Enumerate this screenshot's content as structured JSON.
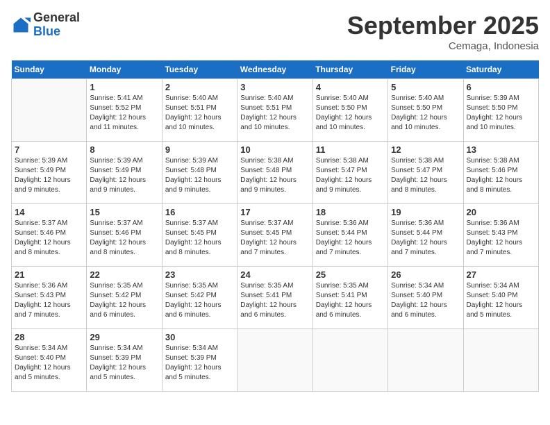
{
  "header": {
    "logo_general": "General",
    "logo_blue": "Blue",
    "month_title": "September 2025",
    "location": "Cemaga, Indonesia"
  },
  "days_of_week": [
    "Sunday",
    "Monday",
    "Tuesday",
    "Wednesday",
    "Thursday",
    "Friday",
    "Saturday"
  ],
  "weeks": [
    [
      {
        "day": "",
        "info": ""
      },
      {
        "day": "1",
        "info": "Sunrise: 5:41 AM\nSunset: 5:52 PM\nDaylight: 12 hours\nand 11 minutes."
      },
      {
        "day": "2",
        "info": "Sunrise: 5:40 AM\nSunset: 5:51 PM\nDaylight: 12 hours\nand 10 minutes."
      },
      {
        "day": "3",
        "info": "Sunrise: 5:40 AM\nSunset: 5:51 PM\nDaylight: 12 hours\nand 10 minutes."
      },
      {
        "day": "4",
        "info": "Sunrise: 5:40 AM\nSunset: 5:50 PM\nDaylight: 12 hours\nand 10 minutes."
      },
      {
        "day": "5",
        "info": "Sunrise: 5:40 AM\nSunset: 5:50 PM\nDaylight: 12 hours\nand 10 minutes."
      },
      {
        "day": "6",
        "info": "Sunrise: 5:39 AM\nSunset: 5:50 PM\nDaylight: 12 hours\nand 10 minutes."
      }
    ],
    [
      {
        "day": "7",
        "info": "Sunrise: 5:39 AM\nSunset: 5:49 PM\nDaylight: 12 hours\nand 9 minutes."
      },
      {
        "day": "8",
        "info": "Sunrise: 5:39 AM\nSunset: 5:49 PM\nDaylight: 12 hours\nand 9 minutes."
      },
      {
        "day": "9",
        "info": "Sunrise: 5:39 AM\nSunset: 5:48 PM\nDaylight: 12 hours\nand 9 minutes."
      },
      {
        "day": "10",
        "info": "Sunrise: 5:38 AM\nSunset: 5:48 PM\nDaylight: 12 hours\nand 9 minutes."
      },
      {
        "day": "11",
        "info": "Sunrise: 5:38 AM\nSunset: 5:47 PM\nDaylight: 12 hours\nand 9 minutes."
      },
      {
        "day": "12",
        "info": "Sunrise: 5:38 AM\nSunset: 5:47 PM\nDaylight: 12 hours\nand 8 minutes."
      },
      {
        "day": "13",
        "info": "Sunrise: 5:38 AM\nSunset: 5:46 PM\nDaylight: 12 hours\nand 8 minutes."
      }
    ],
    [
      {
        "day": "14",
        "info": "Sunrise: 5:37 AM\nSunset: 5:46 PM\nDaylight: 12 hours\nand 8 minutes."
      },
      {
        "day": "15",
        "info": "Sunrise: 5:37 AM\nSunset: 5:46 PM\nDaylight: 12 hours\nand 8 minutes."
      },
      {
        "day": "16",
        "info": "Sunrise: 5:37 AM\nSunset: 5:45 PM\nDaylight: 12 hours\nand 8 minutes."
      },
      {
        "day": "17",
        "info": "Sunrise: 5:37 AM\nSunset: 5:45 PM\nDaylight: 12 hours\nand 7 minutes."
      },
      {
        "day": "18",
        "info": "Sunrise: 5:36 AM\nSunset: 5:44 PM\nDaylight: 12 hours\nand 7 minutes."
      },
      {
        "day": "19",
        "info": "Sunrise: 5:36 AM\nSunset: 5:44 PM\nDaylight: 12 hours\nand 7 minutes."
      },
      {
        "day": "20",
        "info": "Sunrise: 5:36 AM\nSunset: 5:43 PM\nDaylight: 12 hours\nand 7 minutes."
      }
    ],
    [
      {
        "day": "21",
        "info": "Sunrise: 5:36 AM\nSunset: 5:43 PM\nDaylight: 12 hours\nand 7 minutes."
      },
      {
        "day": "22",
        "info": "Sunrise: 5:35 AM\nSunset: 5:42 PM\nDaylight: 12 hours\nand 6 minutes."
      },
      {
        "day": "23",
        "info": "Sunrise: 5:35 AM\nSunset: 5:42 PM\nDaylight: 12 hours\nand 6 minutes."
      },
      {
        "day": "24",
        "info": "Sunrise: 5:35 AM\nSunset: 5:41 PM\nDaylight: 12 hours\nand 6 minutes."
      },
      {
        "day": "25",
        "info": "Sunrise: 5:35 AM\nSunset: 5:41 PM\nDaylight: 12 hours\nand 6 minutes."
      },
      {
        "day": "26",
        "info": "Sunrise: 5:34 AM\nSunset: 5:40 PM\nDaylight: 12 hours\nand 6 minutes."
      },
      {
        "day": "27",
        "info": "Sunrise: 5:34 AM\nSunset: 5:40 PM\nDaylight: 12 hours\nand 5 minutes."
      }
    ],
    [
      {
        "day": "28",
        "info": "Sunrise: 5:34 AM\nSunset: 5:40 PM\nDaylight: 12 hours\nand 5 minutes."
      },
      {
        "day": "29",
        "info": "Sunrise: 5:34 AM\nSunset: 5:39 PM\nDaylight: 12 hours\nand 5 minutes."
      },
      {
        "day": "30",
        "info": "Sunrise: 5:34 AM\nSunset: 5:39 PM\nDaylight: 12 hours\nand 5 minutes."
      },
      {
        "day": "",
        "info": ""
      },
      {
        "day": "",
        "info": ""
      },
      {
        "day": "",
        "info": ""
      },
      {
        "day": "",
        "info": ""
      }
    ]
  ]
}
